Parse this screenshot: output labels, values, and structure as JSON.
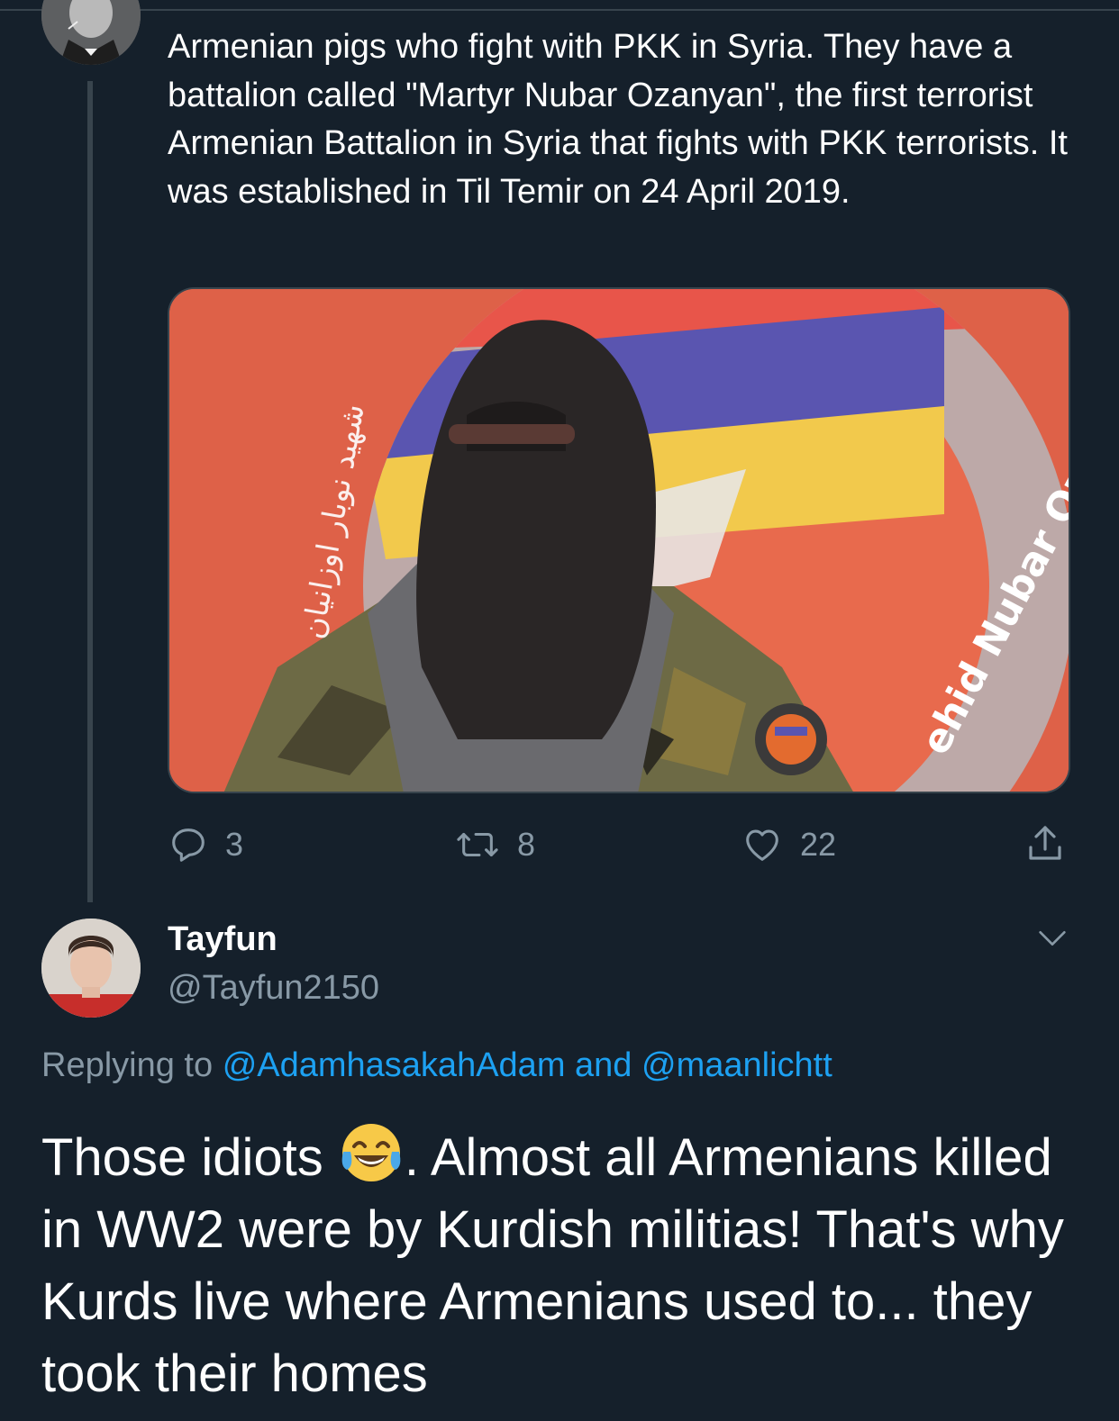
{
  "parent_tweet": {
    "text": "Armenian pigs who fight with PKK in Syria.  They have a battalion called \"Martyr Nubar Ozanyan\", the first terrorist Armenian Battalion in Syria that fights with PKK terrorists. It was established in Til Temir on 24 April 2019.",
    "media": {
      "banner_text_latin": "ehid Nubar Ozanyan",
      "banner_text_arabic": "شهيد نوبار اوزانيان"
    },
    "actions": {
      "replies": "3",
      "retweets": "8",
      "likes": "22"
    }
  },
  "reply_tweet": {
    "display_name": "Tayfun",
    "handle": "@Tayfun2150",
    "replying_prefix": "Replying to",
    "replying_mention_1": "@AdamhasakahAdam",
    "replying_and": "and",
    "replying_mention_2": "@maanlichtt",
    "text_before_emoji": "Those idiots",
    "text_after_emoji": ". Almost all Armenians killed in WW2 were by Kurdish militias! That's why Kurds live where Armenians used to... they took their homes"
  },
  "colors": {
    "background": "#15202b",
    "divider": "#38444d",
    "secondary_text": "#8899a6",
    "link": "#1da1f2"
  },
  "icons": [
    "reply-icon",
    "retweet-icon",
    "like-icon",
    "share-icon",
    "chevron-down-icon",
    "tears-of-joy-emoji"
  ]
}
